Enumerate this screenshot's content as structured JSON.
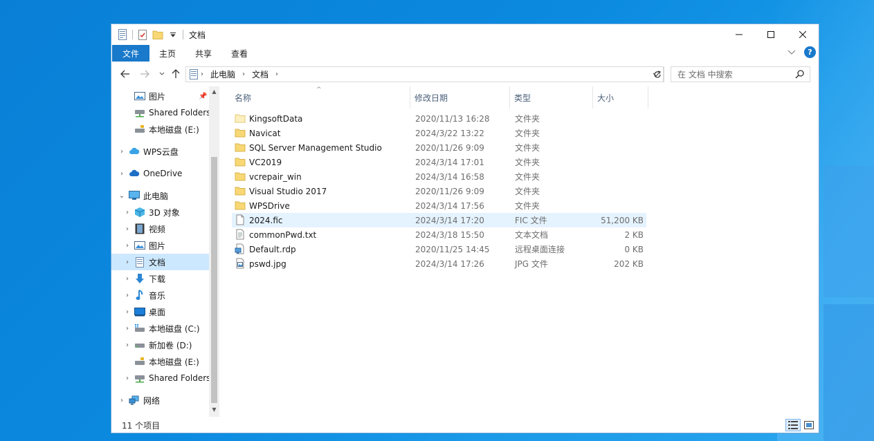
{
  "window": {
    "title": "文档"
  },
  "ribbon": {
    "tabs": [
      {
        "label": "文件"
      },
      {
        "label": "主页"
      },
      {
        "label": "共享"
      },
      {
        "label": "查看"
      }
    ]
  },
  "address": {
    "crumbs": [
      "此电脑",
      "文档"
    ],
    "search_placeholder": "在 文档 中搜索"
  },
  "nav": {
    "items": [
      {
        "label": "图片",
        "icon": "pictures-icon",
        "pinned": true
      },
      {
        "label": "Shared Folders",
        "icon": "network-drive-icon"
      },
      {
        "label": "本地磁盘 (E:)",
        "icon": "locked-drive-icon"
      },
      {
        "label": "WPS云盘",
        "icon": "cloud-icon"
      },
      {
        "label": "OneDrive",
        "icon": "onedrive-icon"
      },
      {
        "label": "此电脑",
        "icon": "this-pc-icon"
      },
      {
        "label": "3D 对象",
        "icon": "3d-objects-icon"
      },
      {
        "label": "视频",
        "icon": "videos-icon"
      },
      {
        "label": "图片",
        "icon": "pictures-icon"
      },
      {
        "label": "文档",
        "icon": "documents-icon"
      },
      {
        "label": "下载",
        "icon": "downloads-icon"
      },
      {
        "label": "音乐",
        "icon": "music-icon"
      },
      {
        "label": "桌面",
        "icon": "desktop-icon"
      },
      {
        "label": "本地磁盘 (C:)",
        "icon": "windows-drive-icon"
      },
      {
        "label": "新加卷 (D:)",
        "icon": "drive-icon"
      },
      {
        "label": "本地磁盘 (E:)",
        "icon": "locked-drive-icon"
      },
      {
        "label": "Shared Folders",
        "icon": "network-drive-icon"
      },
      {
        "label": "网络",
        "icon": "network-icon"
      }
    ]
  },
  "columns": {
    "name": "名称",
    "date": "修改日期",
    "type": "类型",
    "size": "大小"
  },
  "files": [
    {
      "name": "KingsoftData",
      "date": "2020/11/13 16:28",
      "type": "文件夹",
      "size": "",
      "icon": "folder-icon"
    },
    {
      "name": "Navicat",
      "date": "2024/3/22 13:22",
      "type": "文件夹",
      "size": "",
      "icon": "folder-icon"
    },
    {
      "name": "SQL Server Management Studio",
      "date": "2020/11/26 9:09",
      "type": "文件夹",
      "size": "",
      "icon": "folder-icon"
    },
    {
      "name": "VC2019",
      "date": "2024/3/14 17:01",
      "type": "文件夹",
      "size": "",
      "icon": "folder-icon"
    },
    {
      "name": "vcrepair_win",
      "date": "2024/3/14 16:58",
      "type": "文件夹",
      "size": "",
      "icon": "folder-icon"
    },
    {
      "name": "Visual Studio 2017",
      "date": "2020/11/26 9:09",
      "type": "文件夹",
      "size": "",
      "icon": "folder-icon"
    },
    {
      "name": "WPSDrive",
      "date": "2024/3/14 17:56",
      "type": "文件夹",
      "size": "",
      "icon": "folder-icon"
    },
    {
      "name": "2024.fic",
      "date": "2024/3/14 17:20",
      "type": "FIC 文件",
      "size": "51,200 KB",
      "icon": "file-icon"
    },
    {
      "name": "commonPwd.txt",
      "date": "2024/3/18 15:50",
      "type": "文本文档",
      "size": "2 KB",
      "icon": "text-file-icon"
    },
    {
      "name": "Default.rdp",
      "date": "2020/11/25 14:45",
      "type": "远程桌面连接",
      "size": "0 KB",
      "icon": "rdp-file-icon"
    },
    {
      "name": "pswd.jpg",
      "date": "2024/3/14 17:26",
      "type": "JPG 文件",
      "size": "202 KB",
      "icon": "image-file-icon"
    }
  ],
  "status": {
    "count": "11 个项目"
  },
  "colors": {
    "accent": "#1979ca",
    "selection": "#cce8ff",
    "hover": "#e5f3ff",
    "folder": "#f8d775"
  }
}
